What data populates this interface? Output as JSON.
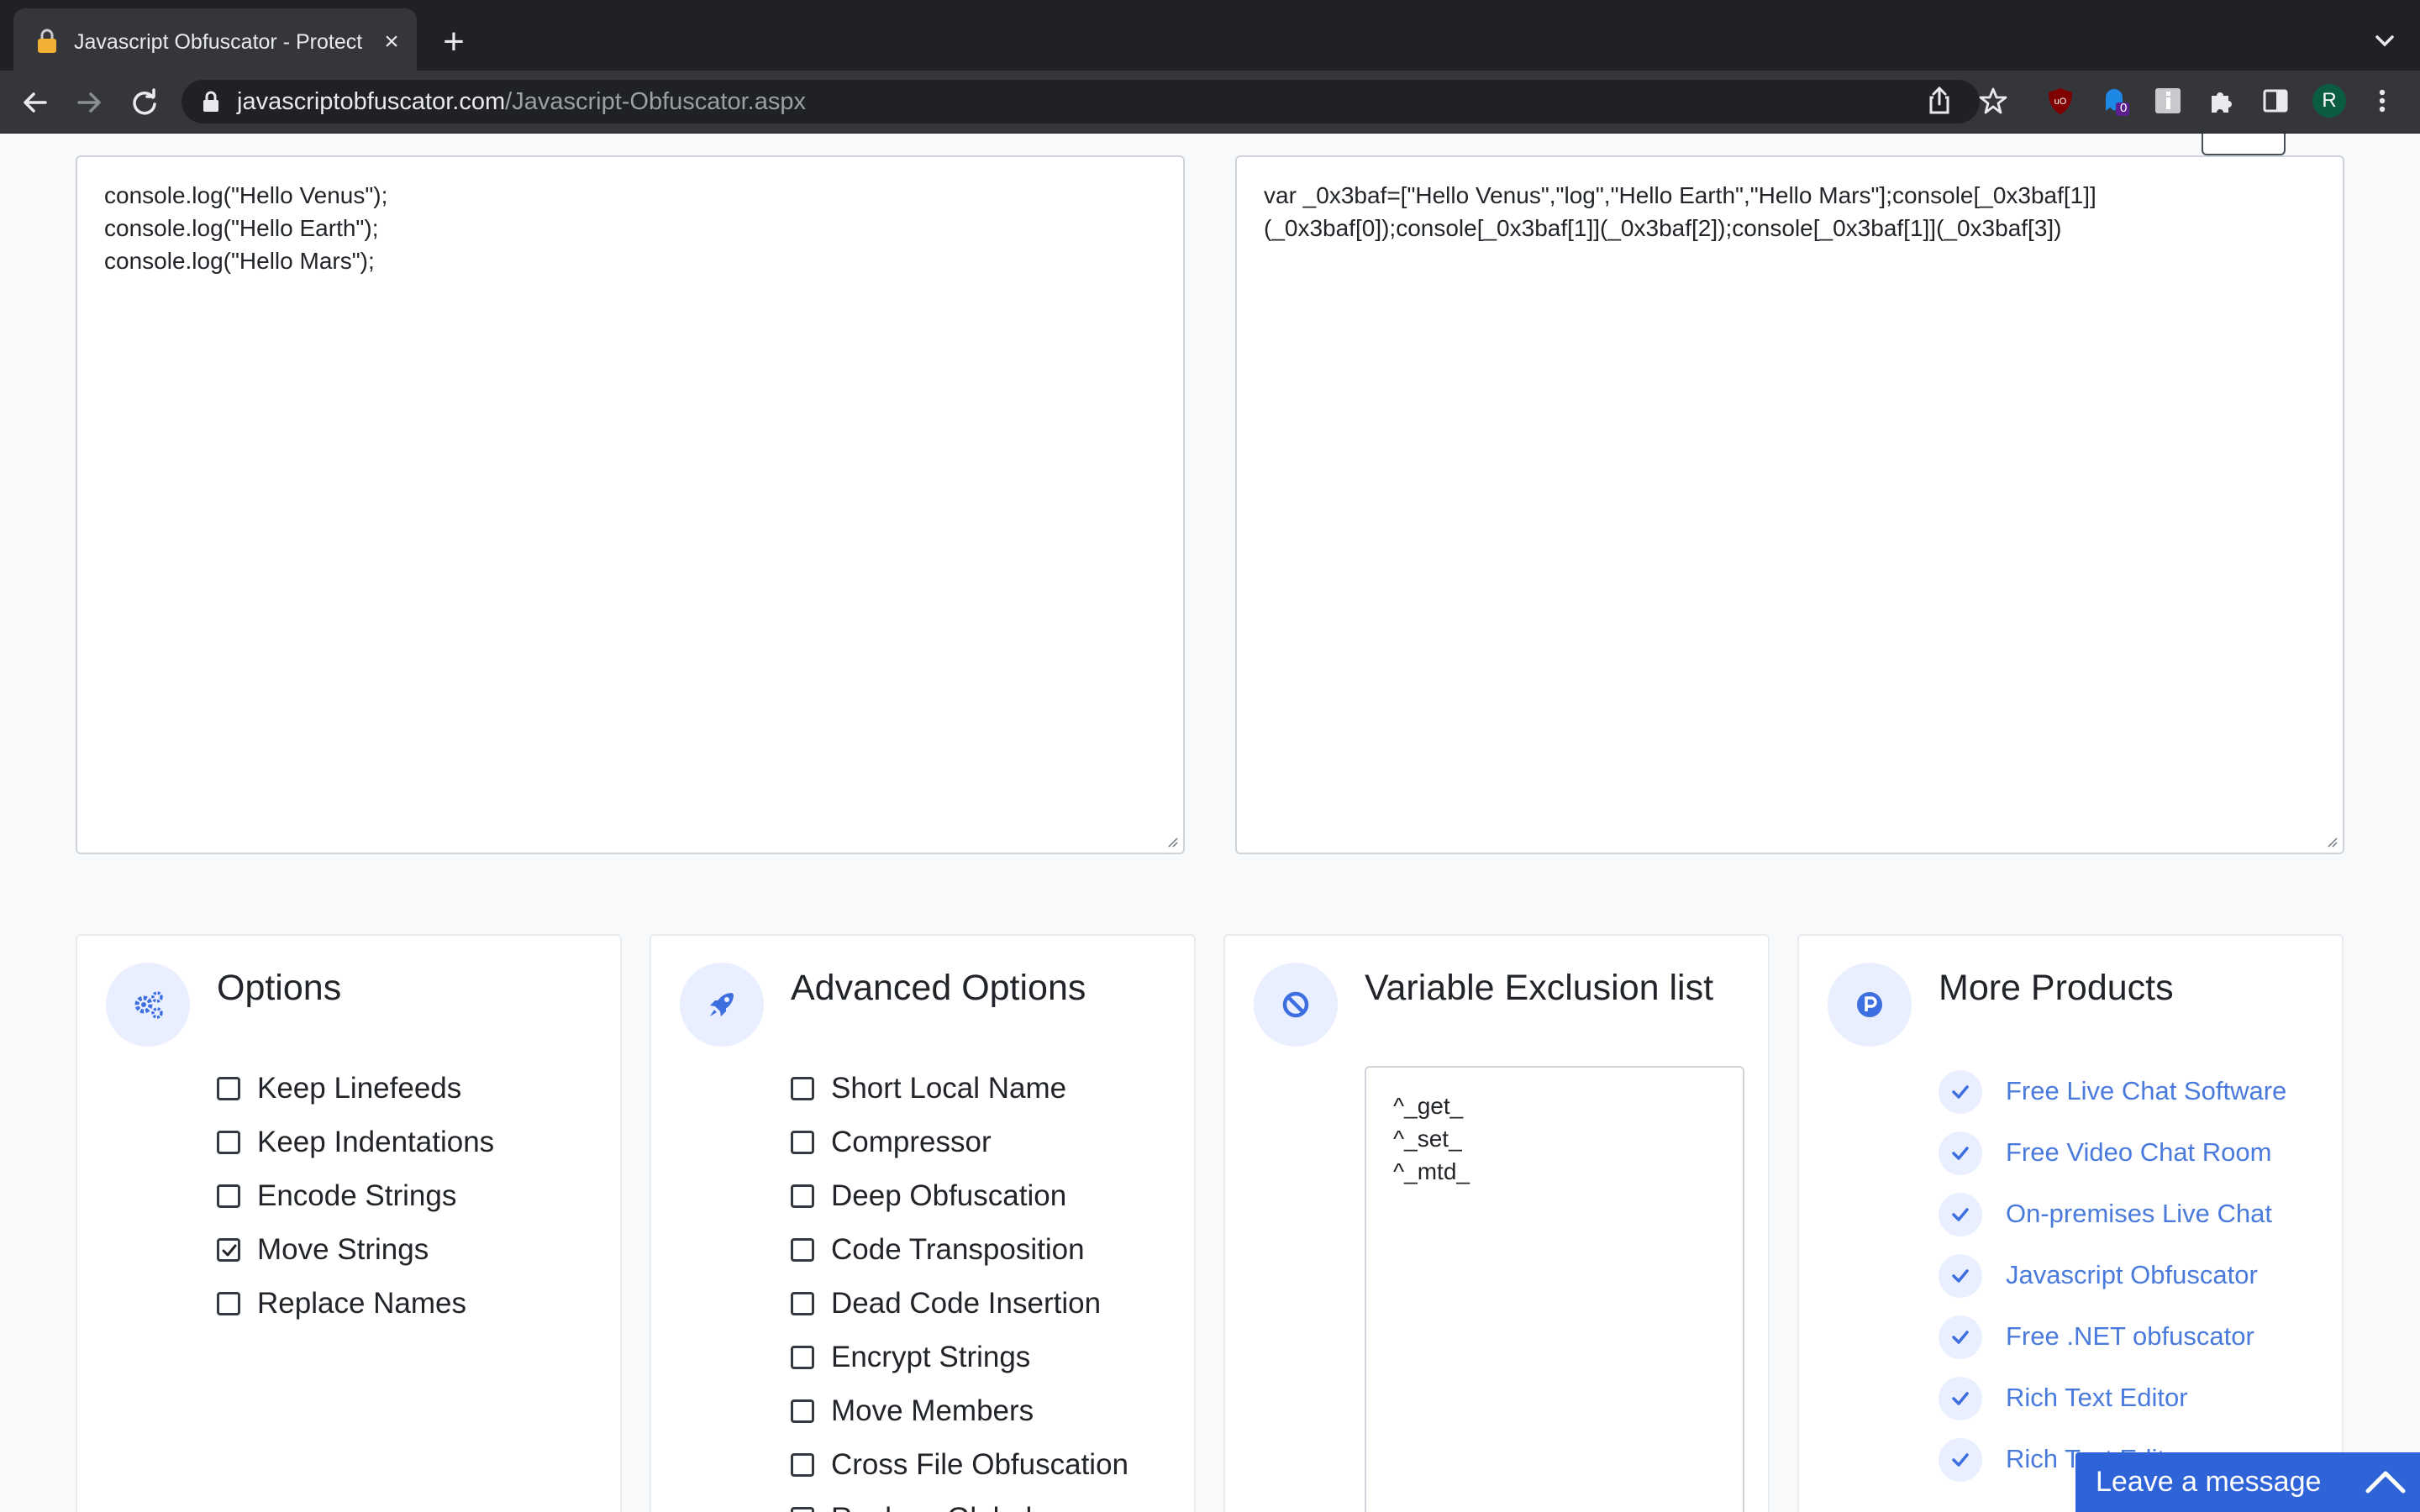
{
  "browser": {
    "tab_title": "Javascript Obfuscator - Protect",
    "url_domain": "javascriptobfuscator.com",
    "url_path": "/Javascript-Obfuscator.aspx",
    "profile_initial": "R",
    "extension_badge": "0"
  },
  "editor": {
    "input_code": "console.log(\"Hello Venus\");\nconsole.log(\"Hello Earth\");\nconsole.log(\"Hello Mars\");",
    "output_code": "var _0x3baf=[\"Hello Venus\",\"log\",\"Hello Earth\",\"Hello Mars\"];console[_0x3baf[1]]\n(_0x3baf[0]);console[_0x3baf[1]](_0x3baf[2]);console[_0x3baf[1]](_0x3baf[3])"
  },
  "options": {
    "title": "Options",
    "icon": "gears-icon",
    "items": [
      {
        "label": "Keep Linefeeds",
        "checked": false
      },
      {
        "label": "Keep Indentations",
        "checked": false
      },
      {
        "label": "Encode Strings",
        "checked": false
      },
      {
        "label": "Move Strings",
        "checked": true
      },
      {
        "label": "Replace Names",
        "checked": false
      }
    ]
  },
  "advanced": {
    "title": "Advanced Options",
    "icon": "rocket-icon",
    "items": [
      {
        "label": "Short Local Name",
        "checked": false
      },
      {
        "label": "Compressor",
        "checked": false
      },
      {
        "label": "Deep Obfuscation",
        "checked": false
      },
      {
        "label": "Code Transposition",
        "checked": false
      },
      {
        "label": "Dead Code Insertion",
        "checked": false
      },
      {
        "label": "Encrypt Strings",
        "checked": false
      },
      {
        "label": "Move Members",
        "checked": false
      },
      {
        "label": "Cross File Obfuscation",
        "checked": false
      },
      {
        "label": "Replace Globals",
        "checked": false
      }
    ]
  },
  "exclusion": {
    "title": "Variable Exclusion list",
    "icon": "ban-icon",
    "value": "^_get_\n^_set_\n^_mtd_"
  },
  "products": {
    "title": "More Products",
    "icon": "p-circle-icon",
    "items": [
      "Free Live Chat Software",
      "Free Video Chat Room",
      "On-premises Live Chat",
      "Javascript Obfuscator",
      "Free .NET obfuscator",
      "Rich Text Editor",
      "Rich Text Editor"
    ]
  },
  "chat": {
    "label": "Leave a message"
  },
  "colors": {
    "accent": "#4a7bdc",
    "chat_widget": "#2f63d8",
    "icon_bg": "#e9efff"
  }
}
